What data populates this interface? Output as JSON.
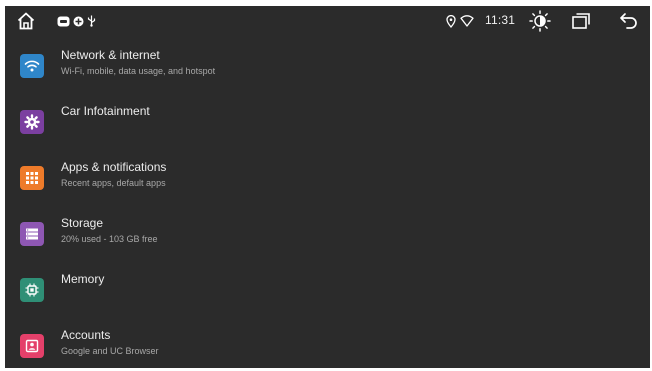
{
  "status_bar": {
    "time": "11:31",
    "icons": {
      "home": "home-icon",
      "notifications": [
        "media-badge-icon",
        "settings-badge-icon",
        "usb-icon"
      ],
      "location": "location-icon",
      "wifi": "wifi-icon",
      "brightness": "brightness-icon",
      "recents": "recents-icon",
      "back": "back-icon"
    }
  },
  "settings": [
    {
      "title": "Network & internet",
      "subtitle": "Wi-Fi, mobile, data usage, and hotspot",
      "icon": "wifi-icon",
      "color": "#2f86c9"
    },
    {
      "title": "Car Infotainment",
      "subtitle": "",
      "icon": "gear-icon",
      "color": "#7b3fa0"
    },
    {
      "title": "Apps & notifications",
      "subtitle": "Recent apps, default apps",
      "icon": "apps-grid-icon",
      "color": "#ee7b2a"
    },
    {
      "title": "Storage",
      "subtitle": "20% used - 103 GB free",
      "icon": "storage-icon",
      "color": "#8e57b3"
    },
    {
      "title": "Memory",
      "subtitle": "",
      "icon": "chip-icon",
      "color": "#2f8f76"
    },
    {
      "title": "Accounts",
      "subtitle": "Google and UC Browser",
      "icon": "account-icon",
      "color": "#e4406a"
    }
  ],
  "colors": {
    "screen_background": "#2b2b2b",
    "title_text": "#ececec",
    "subtitle_text": "#a8a8a8"
  }
}
